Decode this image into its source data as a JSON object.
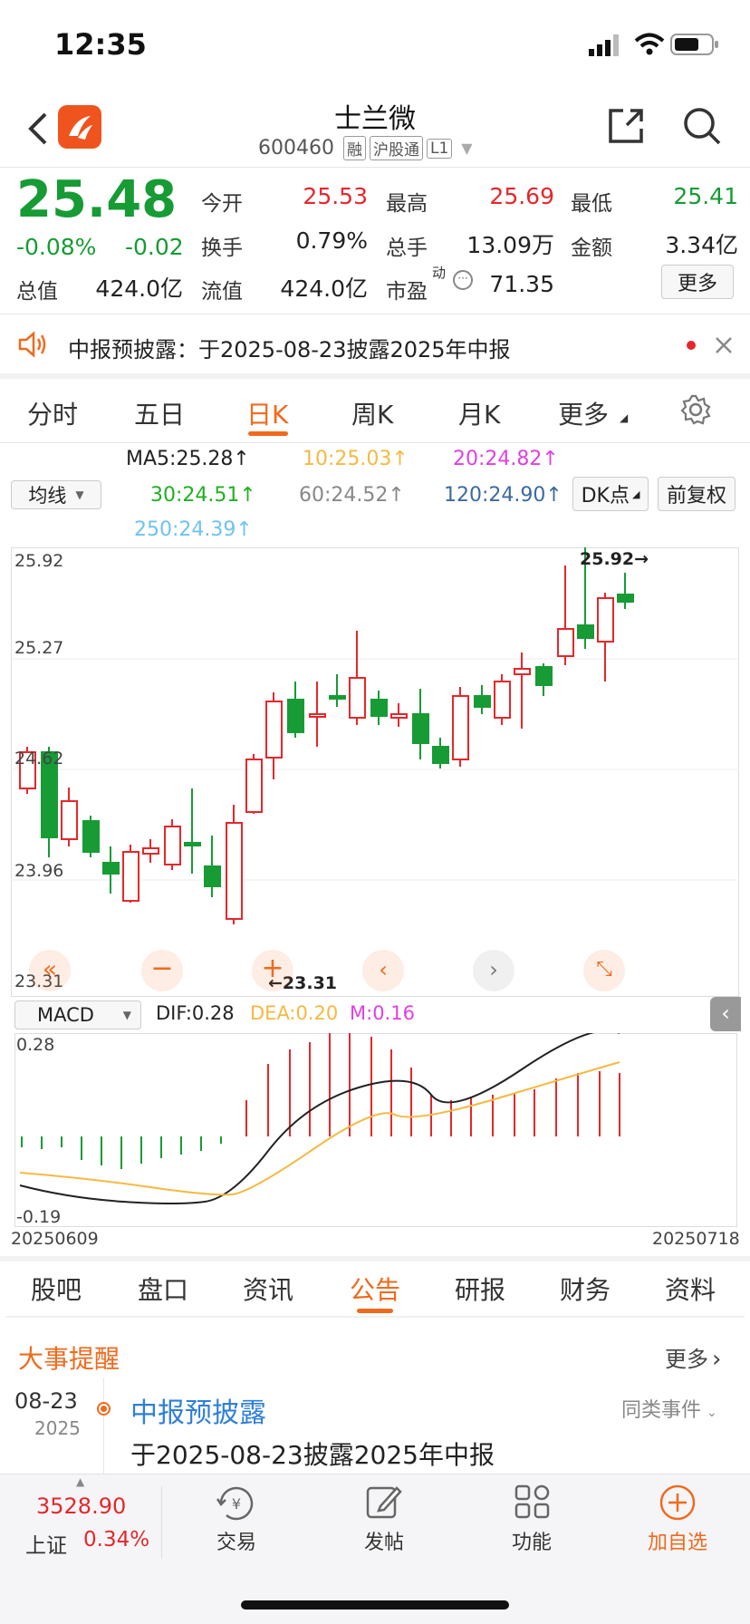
{
  "status": {
    "time": "12:35"
  },
  "header": {
    "title": "士兰微",
    "code": "600460",
    "tags": [
      "融",
      "沪股通",
      "L1"
    ]
  },
  "quote": {
    "price": "25.48",
    "pct": "-0.08%",
    "chg": "-0.02",
    "open_label": "今开",
    "open": "25.53",
    "high_label": "最高",
    "high": "25.69",
    "low_label": "最低",
    "low": "25.41",
    "turnover_label": "换手",
    "turnover": "0.79%",
    "volume_label": "总手",
    "volume": "13.09万",
    "amount_label": "金额",
    "amount": "3.34亿",
    "mcap_label": "总值",
    "mcap": "424.0亿",
    "float_label": "流值",
    "float": "424.0亿",
    "pe_label": "市盈",
    "pe_sup": "动",
    "pe": "71.35",
    "more": "更多"
  },
  "notice": {
    "text": "中报预披露：于2025-08-23披露2025年中报"
  },
  "chart_tabs": {
    "items": [
      "分时",
      "五日",
      "日K",
      "周K",
      "月K",
      "更多"
    ],
    "active": 2
  },
  "ma": {
    "selector": "均线",
    "ma5": "MA5:25.28↑",
    "ma10": "10:25.03↑",
    "ma20": "20:24.82↑",
    "ma30": "30:24.51↑",
    "ma60": "60:24.52↑",
    "ma120": "120:24.90↑",
    "ma250": "250:24.39↑",
    "dk": "DK点",
    "fq": "前复权",
    "colors": {
      "ma5": "#222222",
      "ma10": "#f5b942",
      "ma20": "#e040e0",
      "ma30": "#20b020",
      "ma60": "#888888",
      "ma120": "#3b6aa0",
      "ma250": "#6ec3f0"
    }
  },
  "kchart": {
    "y_labels": [
      "25.92",
      "25.27",
      "24.62",
      "23.96",
      "23.31"
    ],
    "max_mark": "25.92→",
    "min_mark": "←23.31"
  },
  "macd": {
    "selector": "MACD",
    "dif": "DIF:0.28",
    "dea": "DEA:0.20",
    "m": "M:0.16",
    "top": "0.28",
    "bottom": "-0.19",
    "date_start": "20250609",
    "date_end": "20250718"
  },
  "bottom_tabs": {
    "items": [
      "股吧",
      "盘口",
      "资讯",
      "公告",
      "研报",
      "财务",
      "资料"
    ],
    "active": 3
  },
  "events": {
    "heading": "大事提醒",
    "more": "更多",
    "date": "08-23",
    "year": "2025",
    "title": "中报预披露",
    "similar": "同类事件",
    "desc": "于2025-08-23披露2025年中报"
  },
  "nav": {
    "index_value": "3528.90",
    "index_name": "上证",
    "index_pct": "0.34%",
    "items": [
      "交易",
      "发帖",
      "功能",
      "加自选"
    ]
  }
}
